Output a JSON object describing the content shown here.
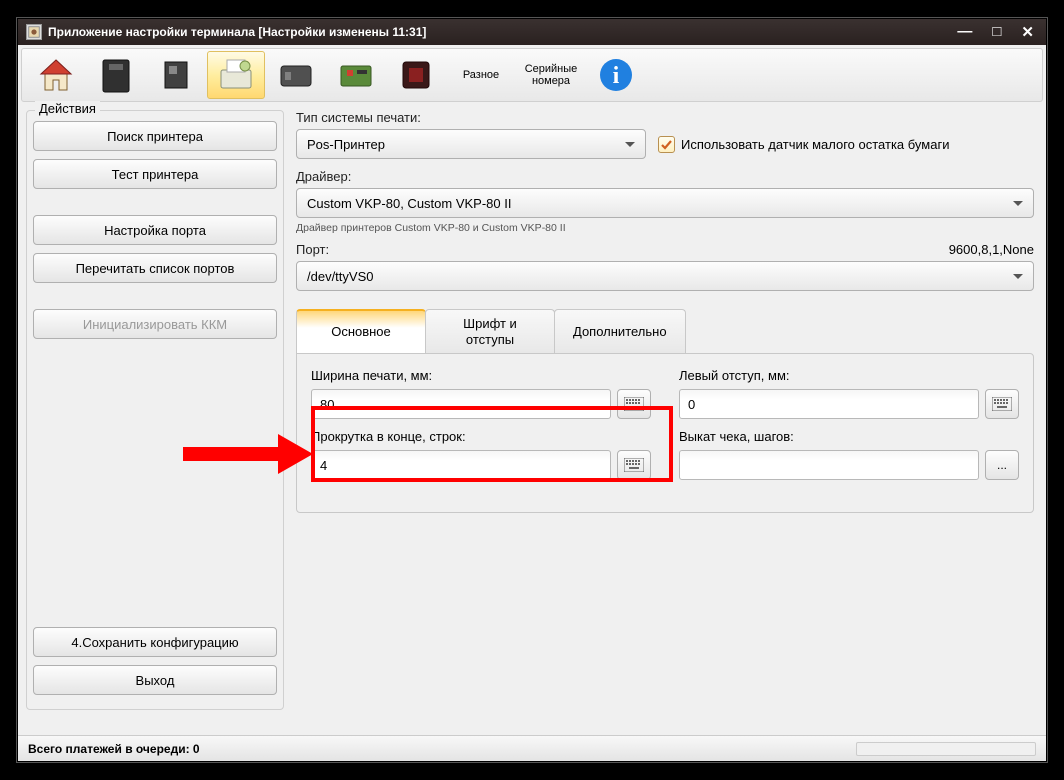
{
  "title": "Приложение настройки терминала [Настройки изменены 11:31]",
  "toolbar": {
    "misc_label": "Разное",
    "serial_label": "Серийные\nномера"
  },
  "sidebar": {
    "legend": "Действия",
    "search_printer": "Поиск принтера",
    "test_printer": "Тест принтера",
    "port_settings": "Настройка порта",
    "reread_ports": "Перечитать список портов",
    "init_kkm": "Инициализировать ККМ",
    "save_config": "4.Сохранить конфигурацию",
    "exit": "Выход"
  },
  "main": {
    "print_system_label": "Тип системы печати:",
    "print_system_value": "Pos-Принтер",
    "use_sensor": "Использовать датчик малого остатка бумаги",
    "driver_label": "Драйвер:",
    "driver_value": "Custom VKP-80, Custom VKP-80 II",
    "driver_hint": "Драйвер принтеров Custom VKP-80 и Custom VKP-80 II",
    "port_label": "Порт:",
    "port_info": "9600,8,1,None",
    "port_value": "/dev/ttyVS0",
    "tabs": {
      "main": "Основное",
      "font": "Шрифт и\nотступы",
      "extra": "Дополнительно"
    },
    "fields": {
      "print_width_label": "Ширина печати, мм:",
      "print_width_value": "80",
      "left_margin_label": "Левый отступ, мм:",
      "left_margin_value": "0",
      "scroll_end_label": "Прокрутка в конце, строк:",
      "scroll_end_value": "4",
      "eject_label": "Выкат чека, шагов:",
      "eject_value": ""
    }
  },
  "statusbar": "Всего платежей в очереди:  0"
}
